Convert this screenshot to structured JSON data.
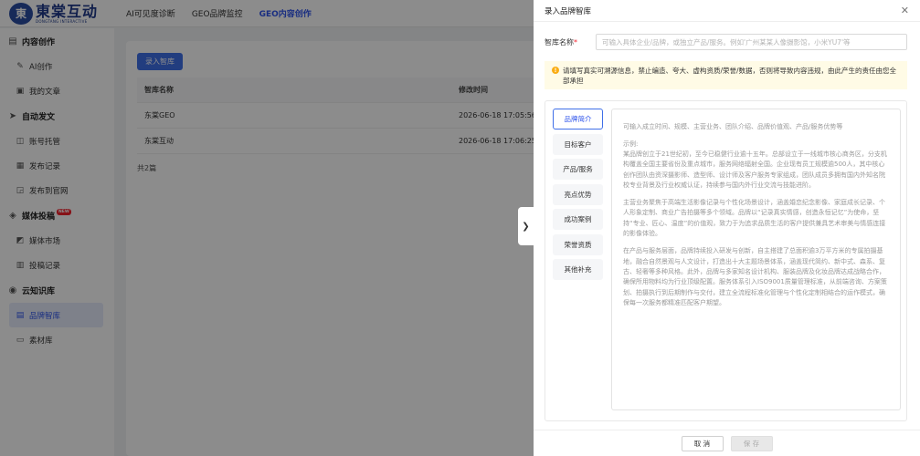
{
  "logo": {
    "mark": "東",
    "cn": "東棠互动",
    "en": "DONGTANG INTERACTIVE"
  },
  "topnav": [
    {
      "label": "AI可见度诊断",
      "active": false
    },
    {
      "label": "GEO品牌监控",
      "active": false
    },
    {
      "label": "GEO内容创作",
      "active": true
    }
  ],
  "sidebar": {
    "groups": [
      {
        "title": "内容创作",
        "icon": "document-icon",
        "items": [
          {
            "label": "AI创作",
            "icon": "pen-icon"
          },
          {
            "label": "我的文章",
            "icon": "article-icon"
          }
        ]
      },
      {
        "title": "自动发文",
        "icon": "send-icon",
        "items": [
          {
            "label": "账号托管",
            "icon": "account-icon"
          },
          {
            "label": "发布记录",
            "icon": "calendar-icon"
          },
          {
            "label": "发布到官网",
            "icon": "website-icon"
          }
        ]
      },
      {
        "title": "媒体投稿",
        "icon": "media-icon",
        "badge": "NEW",
        "items": [
          {
            "label": "媒体市场",
            "icon": "market-icon"
          },
          {
            "label": "投稿记录",
            "icon": "record-icon"
          }
        ]
      },
      {
        "title": "云知识库",
        "icon": "database-icon",
        "items": [
          {
            "label": "品牌智库",
            "icon": "brand-icon",
            "active": true
          },
          {
            "label": "素材库",
            "icon": "folder-icon"
          }
        ]
      }
    ]
  },
  "main": {
    "add_button": "录入智库",
    "table": {
      "headers": [
        "智库名称",
        "修改时间"
      ],
      "rows": [
        [
          "东棠GEO",
          "2026-06-18 17:05:56"
        ],
        [
          "东棠互动",
          "2026-06-18 17:06:25"
        ]
      ]
    },
    "total": "共2篇"
  },
  "drawer": {
    "title": "录入品牌智库",
    "name_label": "智库名称",
    "name_placeholder": "可输入具体企业/品牌，或独立产品/服务。例如'广州某某人像摄影馆，小米YU7'等",
    "warning": "请填写真实可溯源信息，禁止编造、夸大、虚构资质/荣誉/数据，否则将导致内容违规，由此产生的责任由您全部承担",
    "tabs": [
      "品牌简介",
      "目标客户",
      "产品/服务",
      "亮点优势",
      "成功案例",
      "荣誉资质",
      "其他补充"
    ],
    "active_tab": 0,
    "textarea": {
      "hint": "可输入成立时间、规模、主营业务、团队介绍、品牌价值观、产品/服务优势等",
      "example_label": "示例:",
      "para1": "某品牌创立于21世纪初，至今已稳健行业逾十五年。总部设立于一线城市核心商务区，分支机构覆盖全国主要省份及重点城市，服务网络辐射全国。企业现有员工规模逾500人，其中核心创作团队由资深摄影师、造型师、设计师及客户服务专家组成，团队成员多拥有国内外知名院校专业背景及行业权威认证，持续参与国内外行业交流与技能进阶。",
      "para2": "主营业务聚焦于高端生活影像记录与个性化场景设计，涵盖婚恋纪念影像、家庭成长记录、个人形象定制、商业广告拍摄等多个领域。品牌以“记录真实情感，创造永恒记忆”为使命，坚持“专业、匠心、温度”的价值观，致力于为追求品质生活的客户提供兼具艺术审美与情感连接的影像体验。",
      "para3": "在产品与服务层面，品牌持续投入研发与创新，自主搭建了总面积逾3万平方米的专属拍摄基地，融合自然景观与人文设计，打造出十大主题场景体系，涵盖现代简约、新中式、森系、复古、轻奢等多种风格。此外，品牌与多家知名设计机构、服装品牌及化妆品牌达成战略合作，确保所用物料均为行业顶级配置。服务体系引入ISO9001质量管理标准，从前端咨询、方案策划、拍摄执行到后期制作与交付，建立全流程标准化管理与个性化定制相结合的运作模式，确保每一次服务都精准匹配客户期望。"
    },
    "cancel": "取 消",
    "save": "保 存"
  }
}
